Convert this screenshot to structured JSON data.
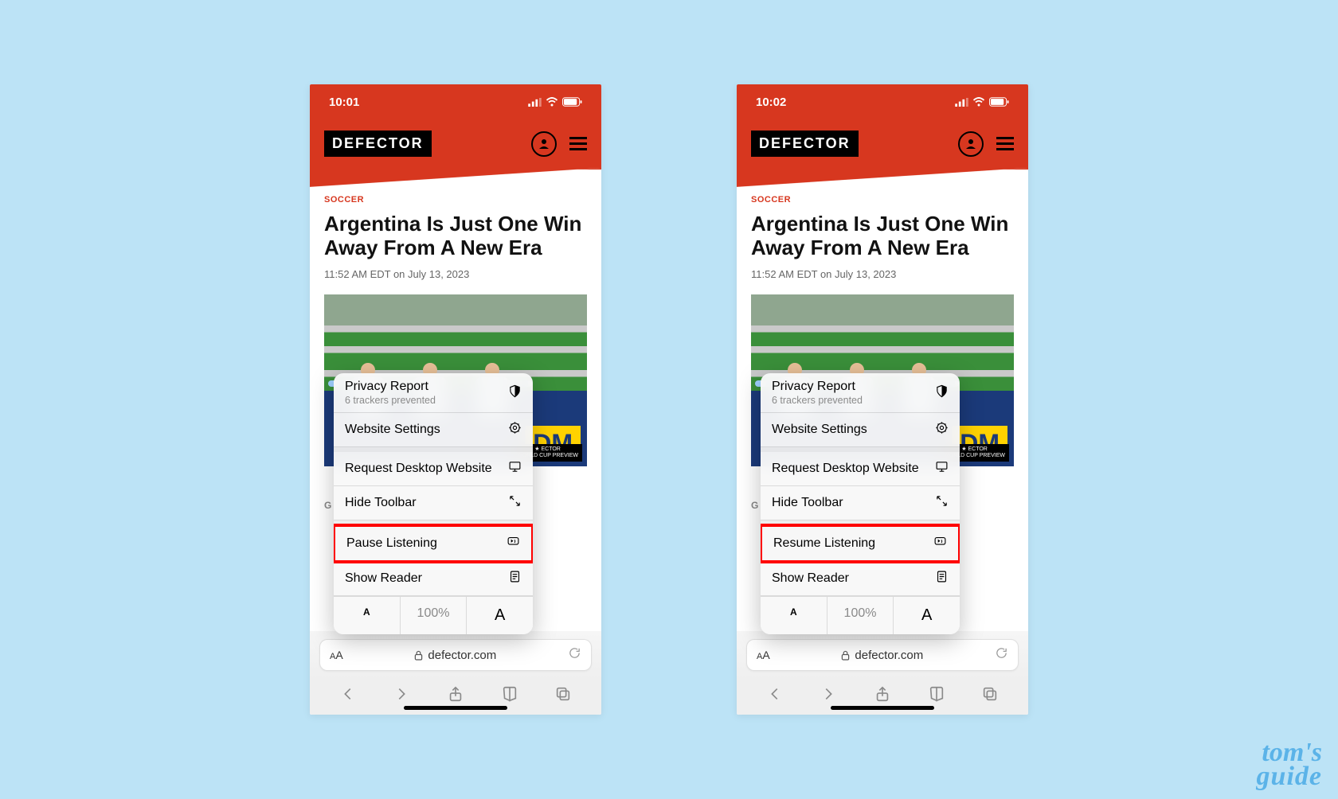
{
  "background_color": "#bce3f6",
  "watermark": {
    "line1": "tom's",
    "line2": "guide"
  },
  "screens": [
    {
      "status": {
        "time": "10:01"
      },
      "site": {
        "logo": "DEFECTOR"
      },
      "article": {
        "category": "SOCCER",
        "headline": "Argentina Is Just One Win Away From A New Era",
        "timestamp": "11:52 AM EDT on July 13, 2023",
        "image_ad_text": "DM",
        "image_badge_top": "★ ECTOR",
        "image_badge_bottom": "WORLD CUP PREVIEW",
        "caption_initial": "G"
      },
      "menu": {
        "privacy_title": "Privacy Report",
        "privacy_sub": "6 trackers prevented",
        "website_settings": "Website Settings",
        "request_desktop": "Request Desktop Website",
        "hide_toolbar": "Hide Toolbar",
        "listen_action": "Pause Listening",
        "show_reader": "Show Reader",
        "zoom": {
          "small": "A",
          "value": "100%",
          "big": "A"
        }
      },
      "address": {
        "aa": "AA",
        "lock": "􀎡",
        "domain": "defector.com"
      }
    },
    {
      "status": {
        "time": "10:02"
      },
      "site": {
        "logo": "DEFECTOR"
      },
      "article": {
        "category": "SOCCER",
        "headline": "Argentina Is Just One Win Away From A New Era",
        "timestamp": "11:52 AM EDT on July 13, 2023",
        "image_ad_text": "DM",
        "image_badge_top": "★ ECTOR",
        "image_badge_bottom": "WORLD CUP PREVIEW",
        "caption_initial": "G"
      },
      "menu": {
        "privacy_title": "Privacy Report",
        "privacy_sub": "6 trackers prevented",
        "website_settings": "Website Settings",
        "request_desktop": "Request Desktop Website",
        "hide_toolbar": "Hide Toolbar",
        "listen_action": "Resume Listening",
        "show_reader": "Show Reader",
        "zoom": {
          "small": "A",
          "value": "100%",
          "big": "A"
        }
      },
      "address": {
        "aa": "AA",
        "lock": "􀎡",
        "domain": "defector.com"
      }
    }
  ]
}
